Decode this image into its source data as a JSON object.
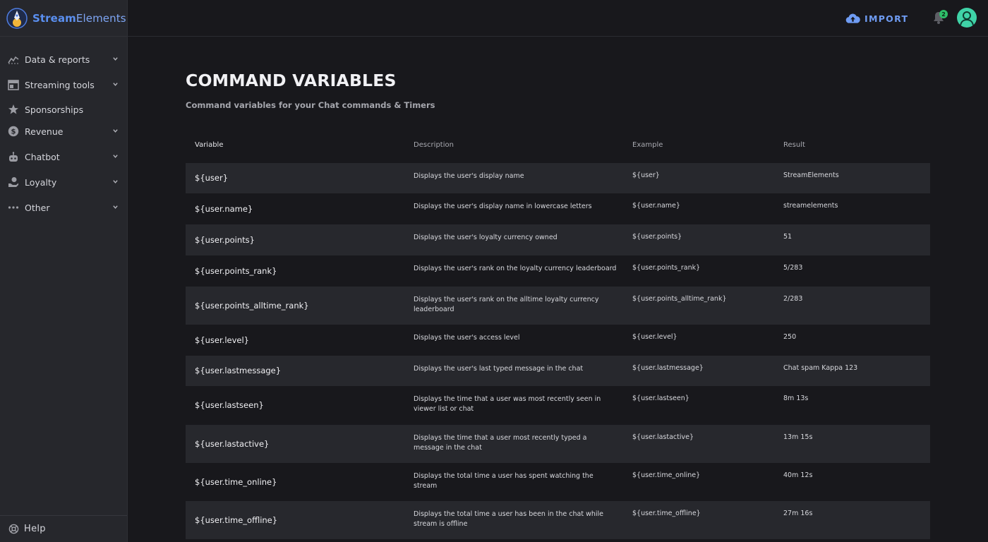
{
  "brand": {
    "name_bold": "Stream",
    "name_light": "Elements"
  },
  "sidebar": {
    "items": [
      {
        "label": "Data & reports",
        "icon": "chart-line-icon",
        "chevron": true
      },
      {
        "label": "Streaming tools",
        "icon": "layout-icon",
        "chevron": true
      },
      {
        "label": "Sponsorships",
        "icon": "star-icon",
        "chevron": false
      },
      {
        "label": "Revenue",
        "icon": "dollar-icon",
        "chevron": true
      },
      {
        "label": "Chatbot",
        "icon": "robot-icon",
        "chevron": true
      },
      {
        "label": "Loyalty",
        "icon": "hand-coin-icon",
        "chevron": true
      },
      {
        "label": "Other",
        "icon": "more-dots-icon",
        "chevron": true
      }
    ],
    "help_label": "Help"
  },
  "topbar": {
    "import_label": "IMPORT",
    "notification_count": "2"
  },
  "page": {
    "title": "COMMAND VARIABLES",
    "subtitle": "Command variables for your Chat commands & Timers"
  },
  "table": {
    "headers": [
      "Variable",
      "Description",
      "Example",
      "Result"
    ],
    "rows": [
      {
        "variable": "${user}",
        "description": "Displays the user's display name",
        "example": "${user}",
        "result": "StreamElements"
      },
      {
        "variable": "${user.name}",
        "description": "Displays the user's display name in lowercase letters",
        "example": "${user.name}",
        "result": "streamelements"
      },
      {
        "variable": "${user.points}",
        "description": "Displays the user's loyalty currency owned",
        "example": "${user.points}",
        "result": "51"
      },
      {
        "variable": "${user.points_rank}",
        "description": "Displays the user's rank on the loyalty currency leaderboard",
        "example": "${user.points_rank}",
        "result": "5/283"
      },
      {
        "variable": "${user.points_alltime_rank}",
        "description": "Displays the user's rank on the alltime loyalty currency leaderboard",
        "example": "${user.points_alltime_rank}",
        "result": "2/283"
      },
      {
        "variable": "${user.level}",
        "description": "Displays the user's access level",
        "example": "${user.level}",
        "result": "250"
      },
      {
        "variable": "${user.lastmessage}",
        "description": "Displays the user's last typed message in the chat",
        "example": "${user.lastmessage}",
        "result": "Chat spam Kappa 123"
      },
      {
        "variable": "${user.lastseen}",
        "description": "Displays the time that a user was most recently seen in viewer list or chat",
        "example": "${user.lastseen}",
        "result": "8m 13s"
      },
      {
        "variable": "${user.lastactive}",
        "description": "Displays the time that a user most recently typed a message in the chat",
        "example": "${user.lastactive}",
        "result": "13m 15s"
      },
      {
        "variable": "${user.time_online}",
        "description": "Displays the total time a user has spent watching the stream",
        "example": "${user.time_online}",
        "result": "40m 12s"
      },
      {
        "variable": "${user.time_offline}",
        "description": "Displays the total time a user has been in the chat while stream is offline",
        "example": "${user.time_offline}",
        "result": "27m 16s"
      }
    ]
  },
  "colors": {
    "background": "#18181c",
    "sidebar": "#26272c",
    "row_alt": "#27282d",
    "accent": "#6f9cf3",
    "avatar": "#3fd3a7",
    "badge": "#2fbf6a"
  }
}
